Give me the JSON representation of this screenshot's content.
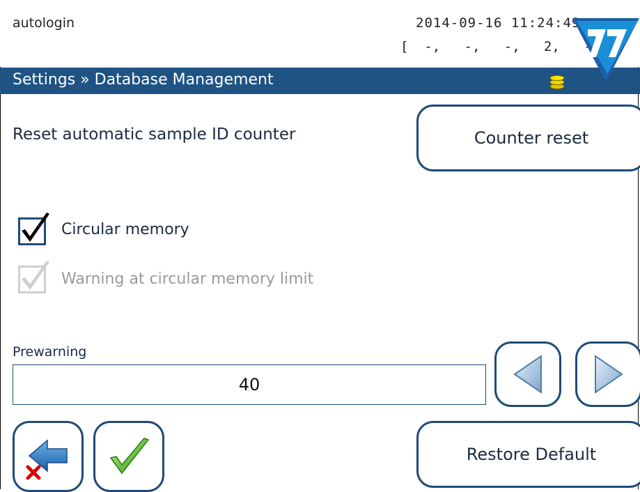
{
  "status_bar": {
    "user": "autologin",
    "datetime": "2014-09-16 11:24:49",
    "indicators": "[  -,   -,   -,   2,   -]"
  },
  "header": {
    "breadcrumb": "Settings » Database Management",
    "icon": "database-icon",
    "accent": "#1f5384"
  },
  "counter": {
    "label": "Reset automatic sample ID counter",
    "button_label": "Counter reset"
  },
  "options": [
    {
      "label": "Circular memory",
      "checked": true,
      "enabled": true
    },
    {
      "label": "Warning at circular memory limit",
      "checked": true,
      "enabled": false
    }
  ],
  "prewarning": {
    "label": "Prewarning",
    "value": "40"
  },
  "footer": {
    "back_icon": "back-arrow-cancel-icon",
    "ok_icon": "checkmark-icon",
    "restore_label": "Restore Default"
  },
  "logo": "77-logo"
}
